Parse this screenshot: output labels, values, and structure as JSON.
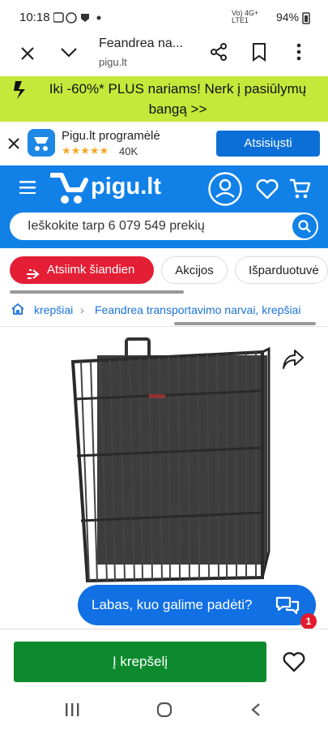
{
  "status_bar": {
    "time": "10:18",
    "battery": "94%",
    "network": "Vo) 4G+ LTE1"
  },
  "browser": {
    "title": "Feandrea na...",
    "url": "pigu.lt"
  },
  "promo": {
    "text": "Iki -60%* PLUS nariams! Nerk į pasiūlymų bangą >>"
  },
  "app_banner": {
    "name": "Pigu.lt programėlė",
    "rating_count": "40K",
    "download_label": "Atsisiųsti"
  },
  "header": {
    "logo_text": "pigu.lt"
  },
  "search": {
    "placeholder": "Ieškokite tarp 6 079 549 prekių"
  },
  "chips": [
    {
      "label": "Atsiimk šiandien"
    },
    {
      "label": "Akcijos"
    },
    {
      "label": "Išparduotuvė"
    }
  ],
  "breadcrumb": {
    "item1": "krepšiai",
    "item2": "Feandrea transportavimo narvai, krepšiai"
  },
  "chat": {
    "text": "Labas, kuo galime padėti?",
    "badge": "1"
  },
  "bottom": {
    "cart_label": "Į krepšelį"
  },
  "colors": {
    "brand_blue": "#1181e8",
    "promo_green": "#c6e83a",
    "chip_red": "#e41f35",
    "cart_green": "#0d8a2d"
  }
}
